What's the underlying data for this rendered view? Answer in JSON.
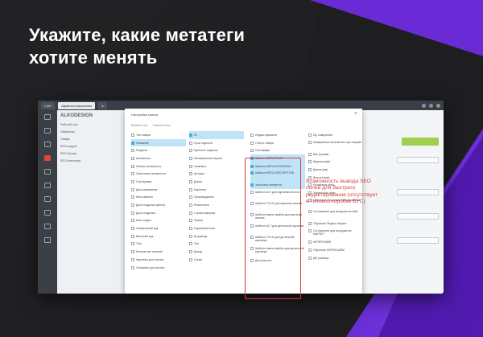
{
  "headline": {
    "line1": "Укажите, какие метатеги",
    "line2": "хотите менять"
  },
  "topbar": {
    "tab1": "Сайт",
    "tab2": "Администрирование",
    "tab3": ""
  },
  "tree": {
    "title": "ALKODESIGN",
    "lines": [
      "Рабочий стол",
      "Избранное",
      "Товары",
      "SEO-модули",
      "SEO Фильтр",
      "SEO-Категории"
    ]
  },
  "modal": {
    "title": "Настройка списка",
    "tabs": [
      "Выбрать все",
      "Отменить все"
    ],
    "columns": [
      [
        {
          "label": "Тип товара",
          "hl": false
        },
        {
          "label": "Название",
          "hl": true
        },
        {
          "label": "Раздела",
          "hl": false
        },
        {
          "label": "Активность",
          "hl": false
        },
        {
          "label": "Начало активности",
          "hl": false
        },
        {
          "label": "Окончание активности",
          "hl": false
        },
        {
          "label": "Сортировка",
          "hl": false
        },
        {
          "label": "Дата изменения",
          "hl": false
        },
        {
          "label": "Кем изменен",
          "hl": false
        },
        {
          "label": "Дата создания (меню)",
          "hl": false
        },
        {
          "label": "Дата создания",
          "hl": false
        },
        {
          "label": "Кем создан",
          "hl": false
        },
        {
          "label": "Символьный код",
          "hl": false
        },
        {
          "label": "Внешний код",
          "hl": false
        },
        {
          "label": "Теги",
          "hl": false
        },
        {
          "label": "Количество показов",
          "hl": false
        },
        {
          "label": "Картинка для анонса",
          "hl": false
        },
        {
          "label": "Описание для анонса",
          "hl": false
        }
      ],
      [
        {
          "label": "ID",
          "hl": true
        },
        {
          "label": "Срок годности",
          "hl": false
        },
        {
          "label": "Крепость изделия",
          "hl": false
        },
        {
          "label": "Минимальная партия",
          "hl": false
        },
        {
          "label": "Упаковка",
          "hl": false
        },
        {
          "label": "Артикул",
          "hl": false
        },
        {
          "label": "Длина",
          "hl": false
        },
        {
          "label": "Картинка",
          "hl": false
        },
        {
          "label": "Производитель",
          "hl": false
        },
        {
          "label": "Резинотаты",
          "hl": false
        },
        {
          "label": "Страна выпуска",
          "hl": false
        },
        {
          "label": "Форма",
          "hl": false
        },
        {
          "label": "Характеристики",
          "hl": false
        },
        {
          "label": "Штрихкод",
          "hl": false
        },
        {
          "label": "Тип",
          "hl": false
        },
        {
          "label": "Бренд",
          "hl": false
        },
        {
          "label": "Серия",
          "hl": false
        }
      ],
      [
        {
          "label": "Индекс времени",
          "hl": false
        },
        {
          "label": "Статус товара",
          "hl": false
        },
        {
          "label": "Поставщик",
          "hl": false
        },
        {
          "label": "Шаблон META TITLE",
          "hl": true
        },
        {
          "label": "Шаблон META KEYWORDS",
          "hl": true
        },
        {
          "label": "Шаблон META DESCRIPTION",
          "hl": true,
          "tall": true
        },
        {
          "label": "Заголовок элемента",
          "hl": true
        },
        {
          "label": "Шаблон ALT для картинки анонса",
          "hl": false,
          "tall": true
        },
        {
          "label": "Шаблон TITLE для картинки анонса",
          "hl": false,
          "tall": true
        },
        {
          "label": "Шаблон имени файла для картинки анонса",
          "hl": false,
          "tall": true
        },
        {
          "label": "Шаблон ALT для детальной картинки",
          "hl": false,
          "tall": true
        },
        {
          "label": "Шаблон TITLE для детальной картинки",
          "hl": false,
          "tall": true
        },
        {
          "label": "Шаблон имени файла для детальной картинки",
          "hl": false,
          "tall": true
        },
        {
          "label": "Доступность",
          "hl": false
        }
      ],
      [
        {
          "label": "Ед. измерения",
          "hl": false
        },
        {
          "label": "Измеряемое количество при покупке",
          "hl": false,
          "tall": true
        },
        {
          "label": "Вес (грамм)",
          "hl": false
        },
        {
          "label": "Ширина (мм)",
          "hl": false
        },
        {
          "label": "Длина (мм)",
          "hl": false
        },
        {
          "label": "Высота (мм)",
          "hl": false
        },
        {
          "label": "Розничная цена",
          "hl": false
        },
        {
          "label": "Закупочная цена",
          "hl": false
        },
        {
          "label": "Обучение с рынками бронирования",
          "hl": false,
          "tall": true
        },
        {
          "label": "Соглашение для выгрузки на сайт",
          "hl": false,
          "tall": true
        },
        {
          "label": "Обучение Яндекс Маркет",
          "hl": false
        },
        {
          "label": "Соглашение для выгрузки на МАРКЕТ",
          "hl": false,
          "tall": true
        },
        {
          "label": "ИНТЕРСАЙМ",
          "hl": false
        },
        {
          "label": "Обучение ИНТЕКСАЙМ",
          "hl": false
        },
        {
          "label": "ДФ розница",
          "hl": false
        }
      ]
    ]
  },
  "callout": "Возможность вывода SEO полей для быстрого редактирования (отсутствует в типовой коробке БУС)",
  "colors": {
    "accent_purple": "#6a2bd6",
    "highlight_box": "#d63b3b",
    "row_highlight": "#bfe3f7"
  }
}
